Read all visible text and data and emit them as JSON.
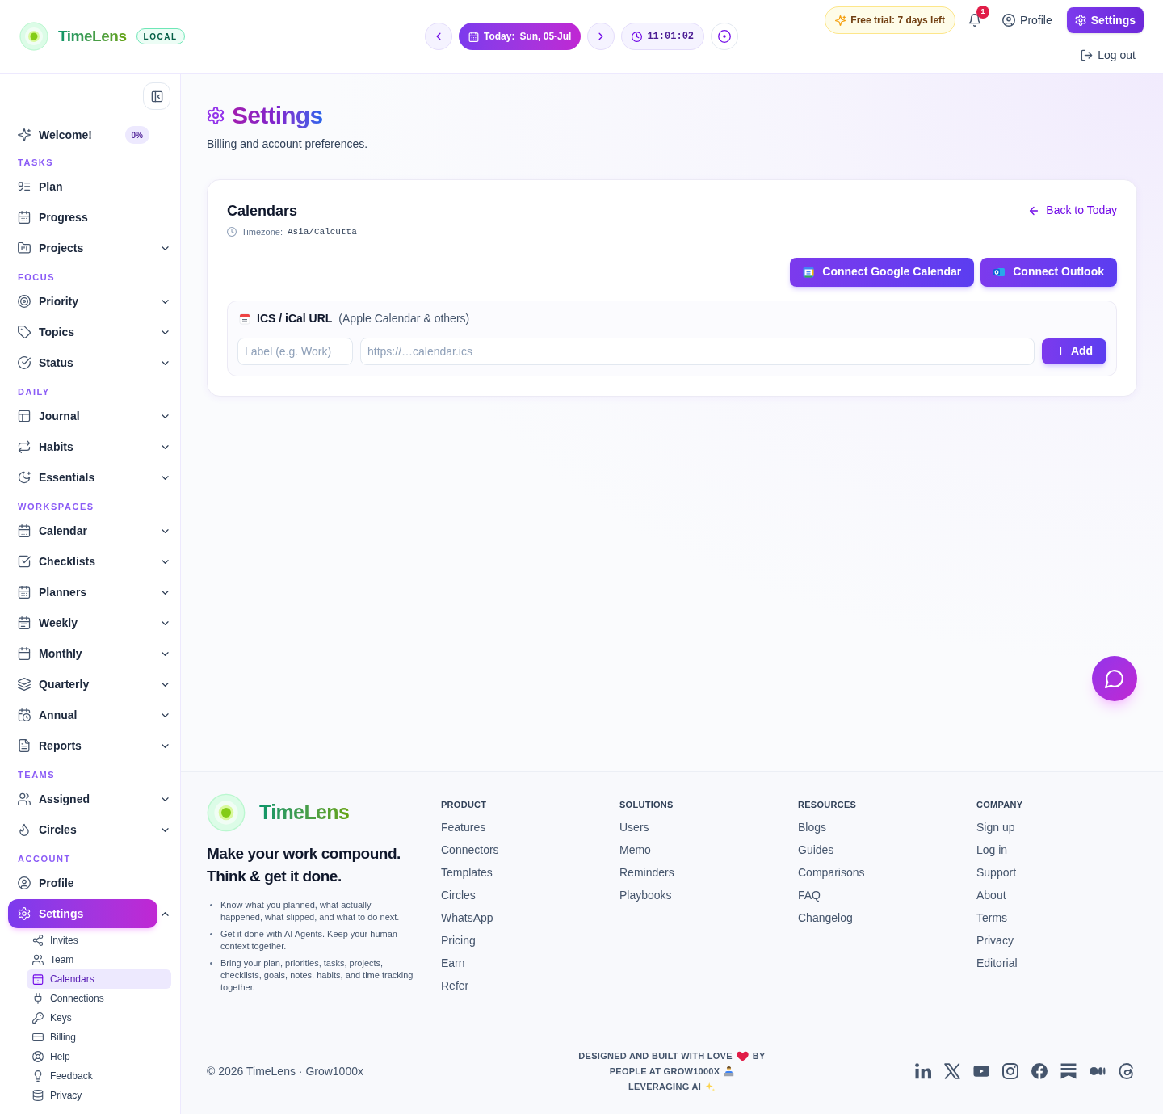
{
  "header": {
    "brand": "TimeLens",
    "mode_badge": "LOCAL",
    "date_prefix": "Today:",
    "date": "Sun, 05-Jul",
    "clock": "11:01:02",
    "trial": "Free trial: 7 days left",
    "notifications": "1",
    "profile": "Profile",
    "settings": "Settings",
    "logout": "Log out"
  },
  "sidebar": {
    "sections": [
      {
        "items": [
          {
            "label": "Welcome!",
            "badge": "0%",
            "selected": false
          }
        ]
      },
      {
        "heading": "TASKS",
        "items": [
          {
            "label": "Plan",
            "selected": false
          },
          {
            "label": "Progress",
            "selected": false
          },
          {
            "label": "Projects",
            "expanded": false,
            "selected": false
          }
        ]
      },
      {
        "heading": "FOCUS",
        "items": [
          {
            "label": "Priority",
            "expanded": false,
            "selected": false
          },
          {
            "label": "Topics",
            "expanded": false,
            "selected": false
          },
          {
            "label": "Status",
            "expanded": false,
            "selected": false
          }
        ]
      },
      {
        "heading": "DAILY",
        "items": [
          {
            "label": "Journal",
            "expanded": false,
            "selected": false
          },
          {
            "label": "Habits",
            "expanded": false,
            "selected": false
          },
          {
            "label": "Essentials",
            "expanded": false,
            "selected": false
          }
        ]
      },
      {
        "heading": "WORKSPACES",
        "items": [
          {
            "label": "Calendar",
            "expanded": false,
            "selected": false
          },
          {
            "label": "Checklists",
            "expanded": false,
            "selected": false
          },
          {
            "label": "Planners",
            "expanded": false,
            "selected": false
          },
          {
            "label": "Weekly",
            "expanded": false,
            "selected": false
          },
          {
            "label": "Monthly",
            "expanded": false,
            "selected": false
          },
          {
            "label": "Quarterly",
            "expanded": false,
            "selected": false
          },
          {
            "label": "Annual",
            "expanded": false,
            "selected": false
          },
          {
            "label": "Reports",
            "expanded": false,
            "selected": false
          }
        ]
      },
      {
        "heading": "TEAMS",
        "items": [
          {
            "label": "Assigned",
            "expanded": false,
            "selected": false
          },
          {
            "label": "Circles",
            "expanded": false,
            "selected": false
          }
        ]
      },
      {
        "heading": "ACCOUNT",
        "items": [
          {
            "label": "Profile",
            "selected": false
          },
          {
            "label": "Settings",
            "expanded": true,
            "selected": true,
            "children": [
              {
                "label": "Invites",
                "selected": false
              },
              {
                "label": "Team",
                "selected": false
              },
              {
                "label": "Calendars",
                "selected": true
              },
              {
                "label": "Connections",
                "selected": false
              },
              {
                "label": "Keys",
                "selected": false
              },
              {
                "label": "Billing",
                "selected": false
              },
              {
                "label": "Help",
                "selected": false
              },
              {
                "label": "Feedback",
                "selected": false
              },
              {
                "label": "Privacy",
                "selected": false
              }
            ]
          }
        ]
      }
    ]
  },
  "page": {
    "title": "Settings",
    "subtitle": "Billing and account preferences."
  },
  "calendars_card": {
    "title": "Calendars",
    "timezone_label": "Timezone:",
    "timezone": "Asia/Calcutta",
    "back_link": "Back to Today",
    "connect_buttons": [
      "Connect Google Calendar",
      "Connect Outlook"
    ],
    "ics": {
      "title": "ICS / iCal URL",
      "note": "(Apple Calendar & others)",
      "label_field": {
        "placeholder": "Label (e.g. Work)"
      },
      "url_field": {
        "placeholder": "https://…calendar.ics"
      },
      "add_button": "Add"
    }
  },
  "footer": {
    "brand": "TimeLens",
    "tagline": [
      "Make your work compound.",
      "Think & get it done."
    ],
    "bullets": [
      "Know what you planned, what actually happened, what slipped, and what to do next.",
      "Get it done with AI Agents. Keep your human context together.",
      "Bring your plan, priorities, tasks, projects, checklists, goals, notes, habits, and time tracking together."
    ],
    "columns": [
      {
        "heading": "PRODUCT",
        "links": [
          "Features",
          "Connectors",
          "Templates",
          "Circles",
          "WhatsApp",
          "Pricing",
          "Earn",
          "Refer"
        ]
      },
      {
        "heading": "SOLUTIONS",
        "links": [
          "Users",
          "Memo",
          "Reminders",
          "Playbooks"
        ]
      },
      {
        "heading": "RESOURCES",
        "links": [
          "Blogs",
          "Guides",
          "Comparisons",
          "FAQ",
          "Changelog"
        ]
      },
      {
        "heading": "COMPANY",
        "links": [
          "Sign up",
          "Log in",
          "Support",
          "About",
          "Terms",
          "Privacy",
          "Editorial"
        ]
      }
    ],
    "copyright": "© 2026 TimeLens · Grow1000x",
    "credit": [
      [
        "DESIGNED AND BUILT WITH LOVE",
        "BY"
      ],
      [
        "PEOPLE AT GROW1000X"
      ],
      [
        "LEVERAGING AI"
      ]
    ]
  }
}
